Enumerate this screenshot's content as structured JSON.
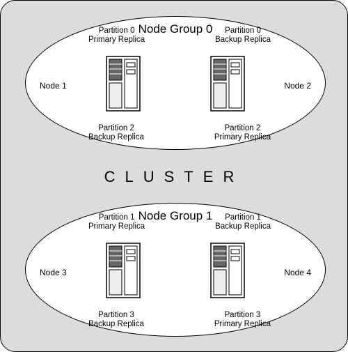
{
  "cluster": {
    "label": "CLUSTER",
    "groups": [
      {
        "title": "Node Group 0",
        "left_node": "Node 1",
        "right_node": "Node 2",
        "tl": {
          "line1": "Partition 0",
          "line2": "Primary Replica"
        },
        "tr": {
          "line1": "Partition 0",
          "line2": "Backup Replica"
        },
        "bl": {
          "line1": "Partition 2",
          "line2": "Backup Replica"
        },
        "br": {
          "line1": "Partition 2",
          "line2": "Primary Replica"
        }
      },
      {
        "title": "Node Group 1",
        "left_node": "Node 3",
        "right_node": "Node 4",
        "tl": {
          "line1": "Partition 1",
          "line2": "Primary Replica"
        },
        "tr": {
          "line1": "Partition 1",
          "line2": "Backup Replica"
        },
        "bl": {
          "line1": "Partition 3",
          "line2": "Backup Replica"
        },
        "br": {
          "line1": "Partition 3",
          "line2": "Primary Replica"
        }
      }
    ]
  }
}
